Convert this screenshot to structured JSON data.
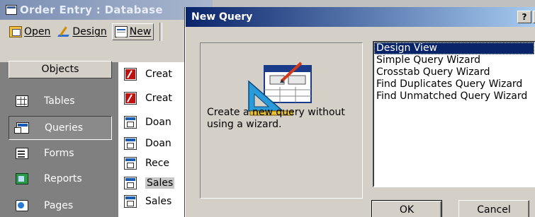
{
  "db_window": {
    "title": "Order Entry : Database",
    "toolbar": {
      "open": "Open",
      "design": "Design",
      "new": "New"
    },
    "objects_header": "Objects",
    "objects": [
      {
        "label": "Tables"
      },
      {
        "label": "Queries",
        "selected": true
      },
      {
        "label": "Forms"
      },
      {
        "label": "Reports"
      },
      {
        "label": "Pages"
      }
    ],
    "list_items": [
      "Creat",
      "Creat",
      "Doan",
      "Doan",
      "Rece",
      "Sales",
      "Sales"
    ]
  },
  "dialog": {
    "title": "New Query",
    "help_glyph": "?",
    "close_glyph": "×",
    "description": "Create a new query without using a wizard.",
    "options": [
      "Design View",
      "Simple Query Wizard",
      "Crosstab Query Wizard",
      "Find Duplicates Query Wizard",
      "Find Unmatched Query Wizard"
    ],
    "selected_option": "Design View",
    "ok_label": "OK",
    "cancel_label": "Cancel"
  }
}
